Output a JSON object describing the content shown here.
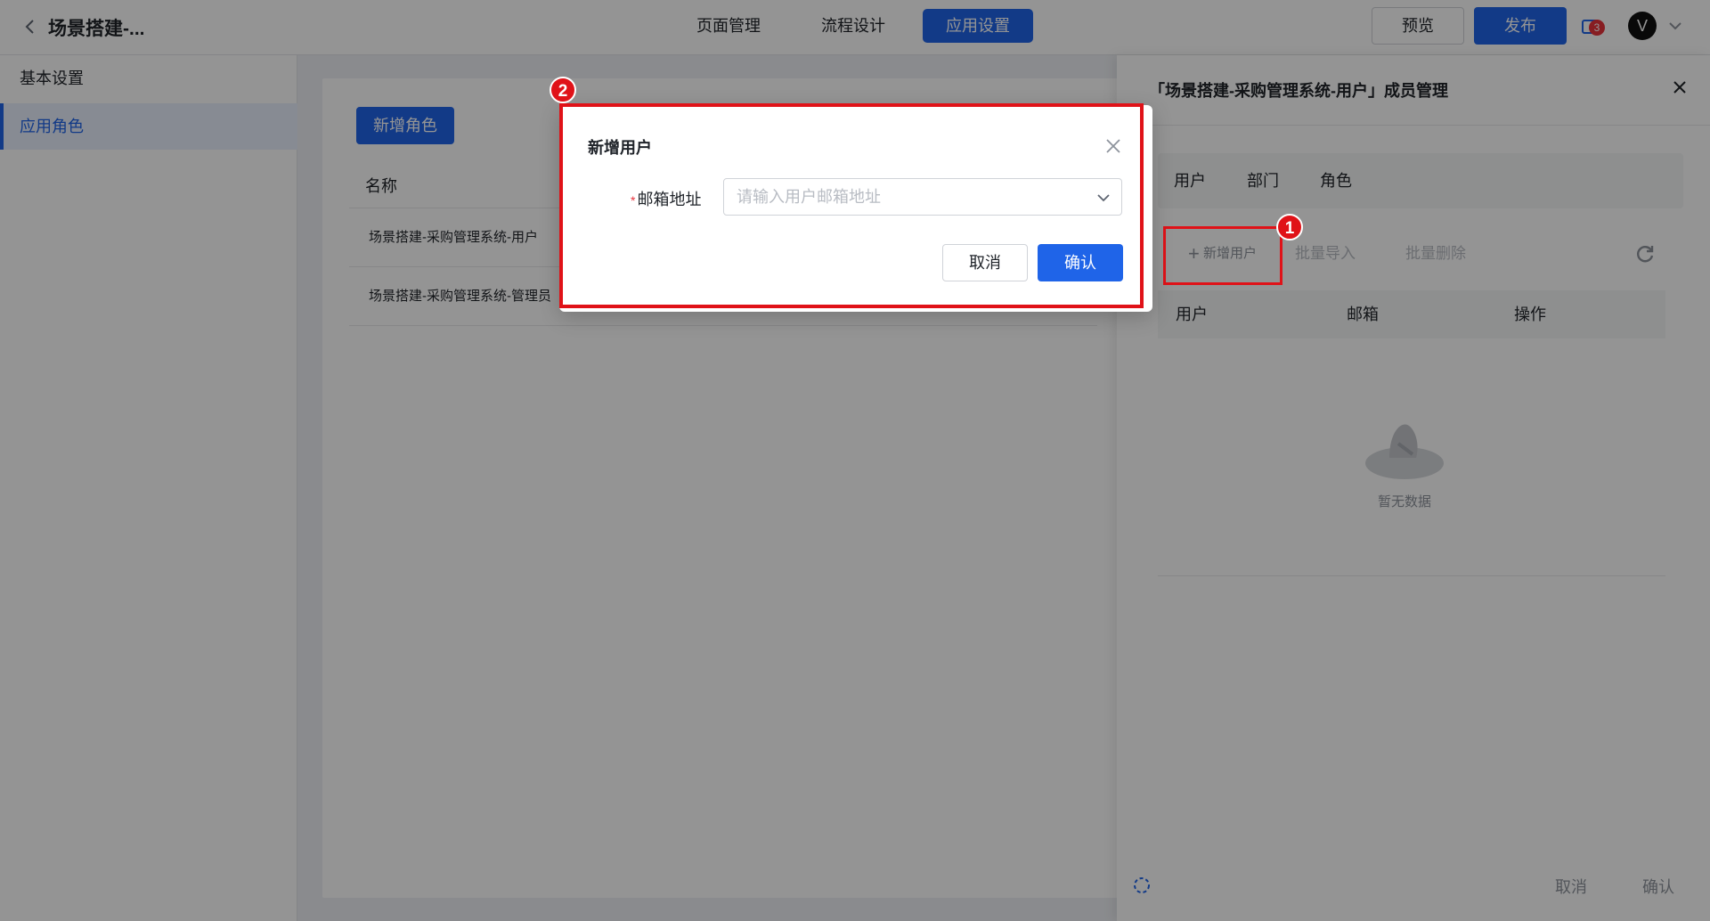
{
  "header": {
    "app_title": "场景搭建-...",
    "tabs": [
      {
        "label": "页面管理"
      },
      {
        "label": "流程设计"
      },
      {
        "label": "应用设置"
      }
    ],
    "preview_label": "预览",
    "publish_label": "发布",
    "message_badge": "3",
    "avatar_letter": "V"
  },
  "sidebar": {
    "items": [
      {
        "label": "基本设置"
      },
      {
        "label": "应用角色"
      }
    ]
  },
  "main": {
    "add_role_label": "新增角色",
    "table": {
      "columns": [
        "名称"
      ],
      "rows": [
        {
          "name": "场景搭建-采购管理系统-用户"
        },
        {
          "name": "场景搭建-采购管理系统-管理员"
        }
      ]
    }
  },
  "drawer": {
    "title": "「场景搭建-采购管理系统-用户」成员管理",
    "tabs": [
      {
        "label": "用户"
      },
      {
        "label": "部门"
      },
      {
        "label": "角色"
      }
    ],
    "toolbar": {
      "add_user_label": "新增用户",
      "batch_import_label": "批量导入",
      "batch_delete_label": "批量删除"
    },
    "columns": [
      "用户",
      "邮箱",
      "操作"
    ],
    "empty_text": "暂无数据",
    "footer": {
      "cancel_label": "取消",
      "confirm_label": "确认"
    }
  },
  "dialog": {
    "title": "新增用户",
    "email_label": "邮箱地址",
    "required_mark": "*",
    "email_placeholder": "请输入用户邮箱地址",
    "email_value": "",
    "cancel_label": "取消",
    "confirm_label": "确认"
  },
  "annotations": {
    "badge_1": "1",
    "badge_2": "2",
    "color": "#e01218"
  },
  "colors": {
    "primary": "#1f64e8",
    "badge_red": "#e8323c"
  }
}
